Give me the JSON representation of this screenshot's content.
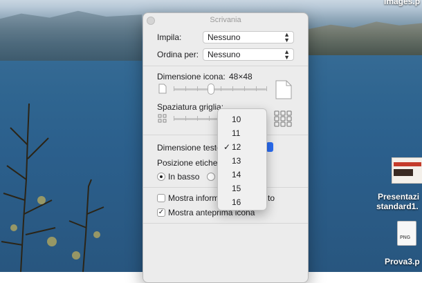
{
  "desktop": {
    "top_right_label": "images.p",
    "file1_label_line1": "Presentazi",
    "file1_label_line2": "standard1.",
    "file2_label": "Prova3.p",
    "png_tag": "PNG"
  },
  "panel": {
    "title": "Scrivania",
    "impila_label": "Impila:",
    "impila_value": "Nessuno",
    "ordina_label": "Ordina per:",
    "ordina_value": "Nessuno",
    "icon_size_label": "Dimensione icona:",
    "icon_size_value": "48×48",
    "icon_size_level": 0.4,
    "grid_spacing_label": "Spaziatura griglia:",
    "text_size_label": "Dimensione testo",
    "label_position_label": "Posizione etichet",
    "radio_bottom_label": "In basso",
    "radio_bottom_checked": true,
    "show_info_label": "Mostra inform",
    "show_info_suffix": "to",
    "show_info_checked": false,
    "show_preview_label": "Mostra anteprima icona",
    "show_preview_checked": true
  },
  "text_size_menu": {
    "options": [
      "10",
      "11",
      "12",
      "13",
      "14",
      "15",
      "16"
    ],
    "selected": "12"
  },
  "colors": {
    "accent": "#2a6df4",
    "panel_bg": "#ececec"
  }
}
